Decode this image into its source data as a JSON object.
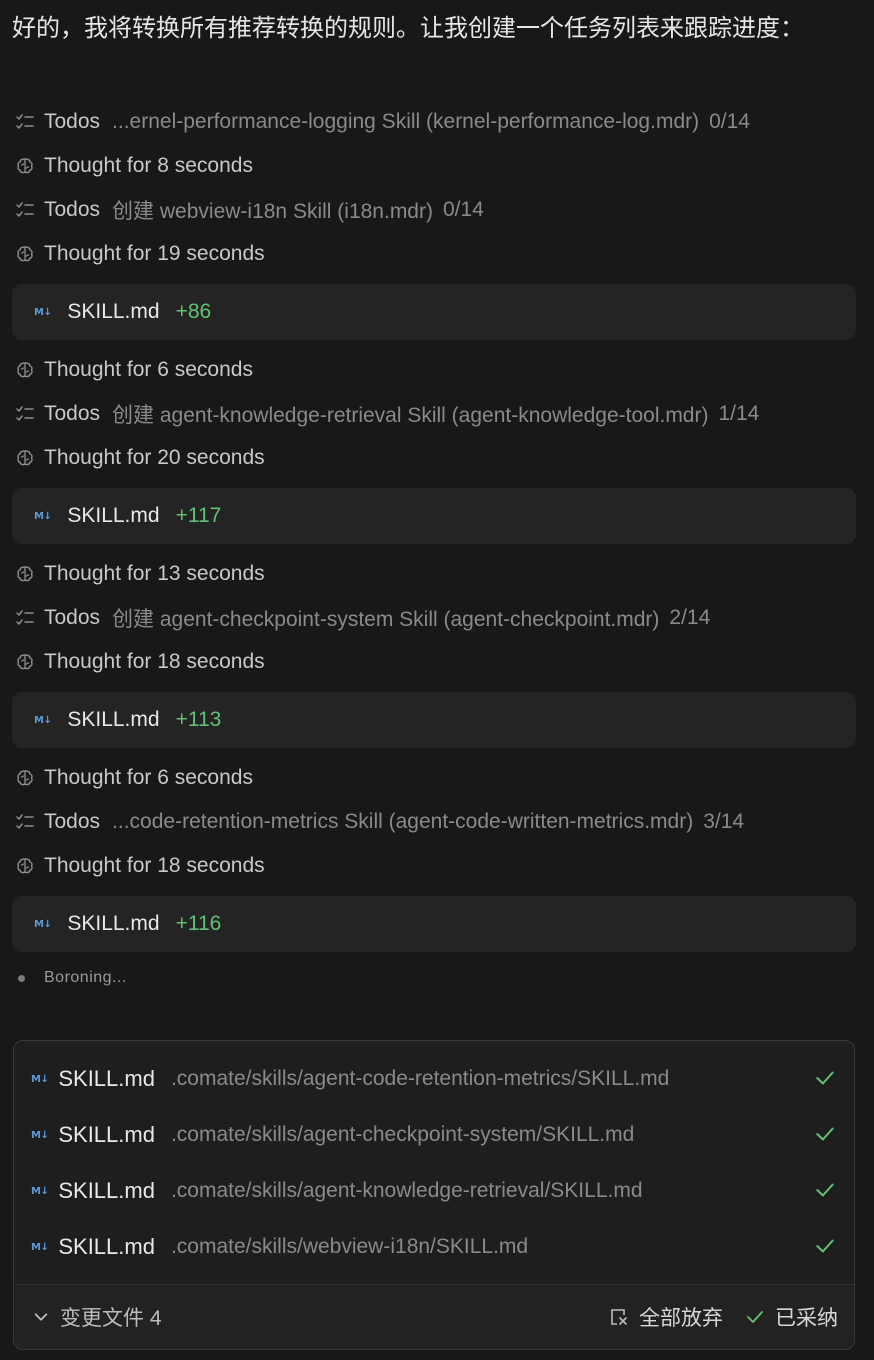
{
  "intro": "好的，我将转换所有推荐转换的规则。让我创建一个任务列表来跟踪进度：",
  "timeline": [
    {
      "kind": "todo",
      "icon": "checklist-icon",
      "label": "Todos",
      "task": "...ernel-performance-logging Skill (kernel-performance-log.mdr)",
      "count": "0/14"
    },
    {
      "kind": "thought",
      "icon": "brain-icon",
      "label": "Thought for 8 seconds"
    },
    {
      "kind": "todo",
      "icon": "checklist-icon",
      "label": "Todos",
      "task": "创建 webview-i18n Skill (i18n.mdr)",
      "count": "0/14"
    },
    {
      "kind": "thought",
      "icon": "brain-icon",
      "label": "Thought for 19 seconds"
    },
    {
      "kind": "file",
      "icon": "markdown-icon",
      "name": "SKILL.md",
      "delta": "+86"
    },
    {
      "kind": "thought",
      "icon": "brain-icon",
      "label": "Thought for 6 seconds"
    },
    {
      "kind": "todo",
      "icon": "checklist-icon",
      "label": "Todos",
      "task": "创建 agent-knowledge-retrieval Skill (agent-knowledge-tool.mdr)",
      "count": "1/14"
    },
    {
      "kind": "thought",
      "icon": "brain-icon",
      "label": "Thought for 20 seconds"
    },
    {
      "kind": "file",
      "icon": "markdown-icon",
      "name": "SKILL.md",
      "delta": "+117"
    },
    {
      "kind": "thought",
      "icon": "brain-icon",
      "label": "Thought for 13 seconds"
    },
    {
      "kind": "todo",
      "icon": "checklist-icon",
      "label": "Todos",
      "task": "创建 agent-checkpoint-system Skill (agent-checkpoint.mdr)",
      "count": "2/14"
    },
    {
      "kind": "thought",
      "icon": "brain-icon",
      "label": "Thought for 18 seconds"
    },
    {
      "kind": "file",
      "icon": "markdown-icon",
      "name": "SKILL.md",
      "delta": "+113"
    },
    {
      "kind": "thought",
      "icon": "brain-icon",
      "label": "Thought for 6 seconds"
    },
    {
      "kind": "todo",
      "icon": "checklist-icon",
      "label": "Todos",
      "task": "...code-retention-metrics Skill (agent-code-written-metrics.mdr)",
      "count": "3/14"
    },
    {
      "kind": "thought",
      "icon": "brain-icon",
      "label": "Thought for 18 seconds"
    },
    {
      "kind": "file",
      "icon": "markdown-icon",
      "name": "SKILL.md",
      "delta": "+116"
    }
  ],
  "status_text": "Boroning...",
  "md_icon_glyph": "M↓",
  "changes": {
    "files": [
      {
        "name": "SKILL.md",
        "path": ".comate/skills/agent-code-retention-metrics/SKILL.md",
        "icon": "check-icon"
      },
      {
        "name": "SKILL.md",
        "path": ".comate/skills/agent-checkpoint-system/SKILL.md",
        "icon": "check-icon"
      },
      {
        "name": "SKILL.md",
        "path": ".comate/skills/agent-knowledge-retrieval/SKILL.md",
        "icon": "check-icon"
      },
      {
        "name": "SKILL.md",
        "path": ".comate/skills/webview-i18n/SKILL.md",
        "icon": "check-icon"
      }
    ],
    "summary_label": "变更文件 4",
    "discard_label": "全部放弃",
    "accepted_label": "已采纳"
  },
  "colors": {
    "background": "#181818",
    "card": "#242424",
    "added": "#63c174",
    "accent": "#5b9bd5"
  }
}
